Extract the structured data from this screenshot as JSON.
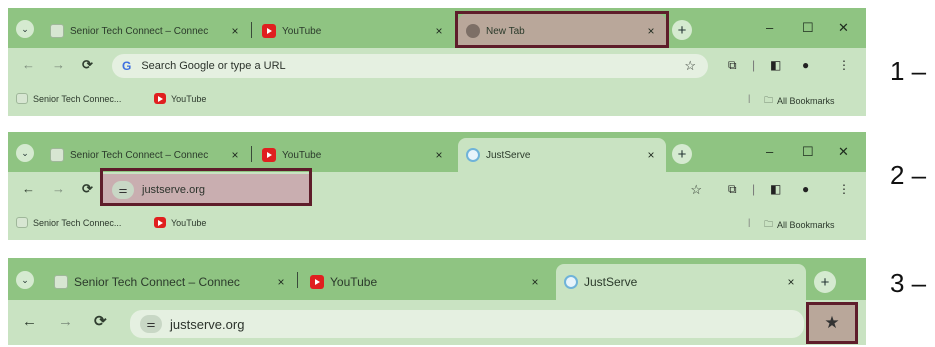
{
  "screen1": {
    "tabs": [
      {
        "label": "Senior Tech Connect – Connec",
        "close": "×"
      },
      {
        "label": "YouTube",
        "close": "×"
      },
      {
        "label": "New Tab",
        "close": "×"
      }
    ],
    "omnibox_placeholder": "Search Google or type a URL",
    "bookmarks": [
      "Senior Tech Connec...",
      "YouTube"
    ],
    "all_bookmarks": "All Bookmarks",
    "step": "1 –"
  },
  "screen2": {
    "tabs": [
      {
        "label": "Senior Tech Connect – Connec",
        "close": "×"
      },
      {
        "label": "YouTube",
        "close": "×"
      },
      {
        "label": "JustServe",
        "close": "×"
      }
    ],
    "url": "justserve.org",
    "bookmarks": [
      "Senior Tech Connec...",
      "YouTube"
    ],
    "all_bookmarks": "All Bookmarks",
    "step": "2 –"
  },
  "screen3": {
    "tabs": [
      {
        "label": "Senior Tech Connect – Connec",
        "close": "×"
      },
      {
        "label": "YouTube",
        "close": "×"
      },
      {
        "label": "JustServe",
        "close": "×"
      }
    ],
    "url": "justserve.org",
    "step": "3 –"
  },
  "icons": {
    "dropdown": "⌄",
    "new_tab": "+",
    "minimize": "–",
    "maximize": "☐",
    "close": "✕",
    "back": "←",
    "forward": "→",
    "reload": "⟳",
    "star": "☆",
    "star_filled": "★",
    "extensions": "⧉",
    "sidepanel": "◧",
    "profile": "●",
    "menu": "⋮",
    "folder": "🗀",
    "google_g": "G",
    "site_info": "⚌"
  },
  "colors": {
    "frame": "#8fc482",
    "toolbar": "#c9e3c2",
    "highlight_border": "#5e1d2a",
    "highlight_fill": "#b9a79a"
  }
}
